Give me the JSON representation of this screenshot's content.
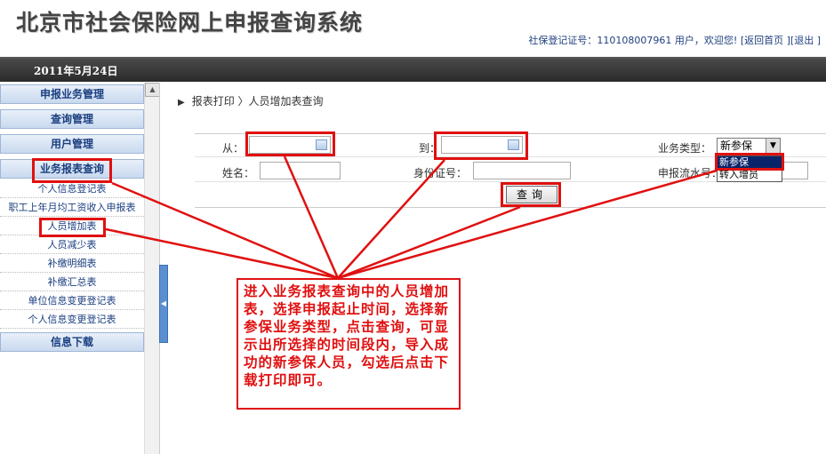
{
  "header": {
    "title": "北京市社会保险网上申报查询系统",
    "cert_label": "社保登记证号：",
    "cert_no": "110108007961",
    "greeting": "用户，欢迎您!",
    "home_link": "[返回首页 ]",
    "logout_link": "[退出 ]"
  },
  "datebar": {
    "date": "2011年5月24日"
  },
  "sidebar": {
    "menus": [
      {
        "label": "申报业务管理"
      },
      {
        "label": "查询管理"
      },
      {
        "label": "用户管理"
      },
      {
        "label": "业务报表查询"
      }
    ],
    "report_items": [
      "个人信息登记表",
      "职工上年月均工资收入申报表",
      "人员增加表",
      "人员减少表",
      "补缴明细表",
      "补缴汇总表",
      "单位信息变更登记表",
      "个人信息变更登记表"
    ],
    "download": "信息下载"
  },
  "breadcrumb": {
    "text": "报表打印 〉人员增加表查询"
  },
  "form": {
    "from_label": "从：",
    "to_label": "到：",
    "biz_type_label": "业务类型：",
    "biz_type_value": "新参保",
    "name_label": "姓名：",
    "id_label": "身份证号：",
    "serial_label": "申报流水号：",
    "query_button": "查询",
    "dropdown_options": [
      "新参保",
      "转入增员"
    ]
  },
  "annotation": {
    "text": "进入业务报表查询中的人员增加表，选择申报起止时间，选择新参保业务类型，点击查询，可显示出所选择的时间段内，导入成功的新参保人员，勾选后点击下载打印即可。"
  },
  "colors": {
    "accent_red": "#e01010",
    "menu_blue": "#1b3f80",
    "selected_option": "#0a246a"
  }
}
